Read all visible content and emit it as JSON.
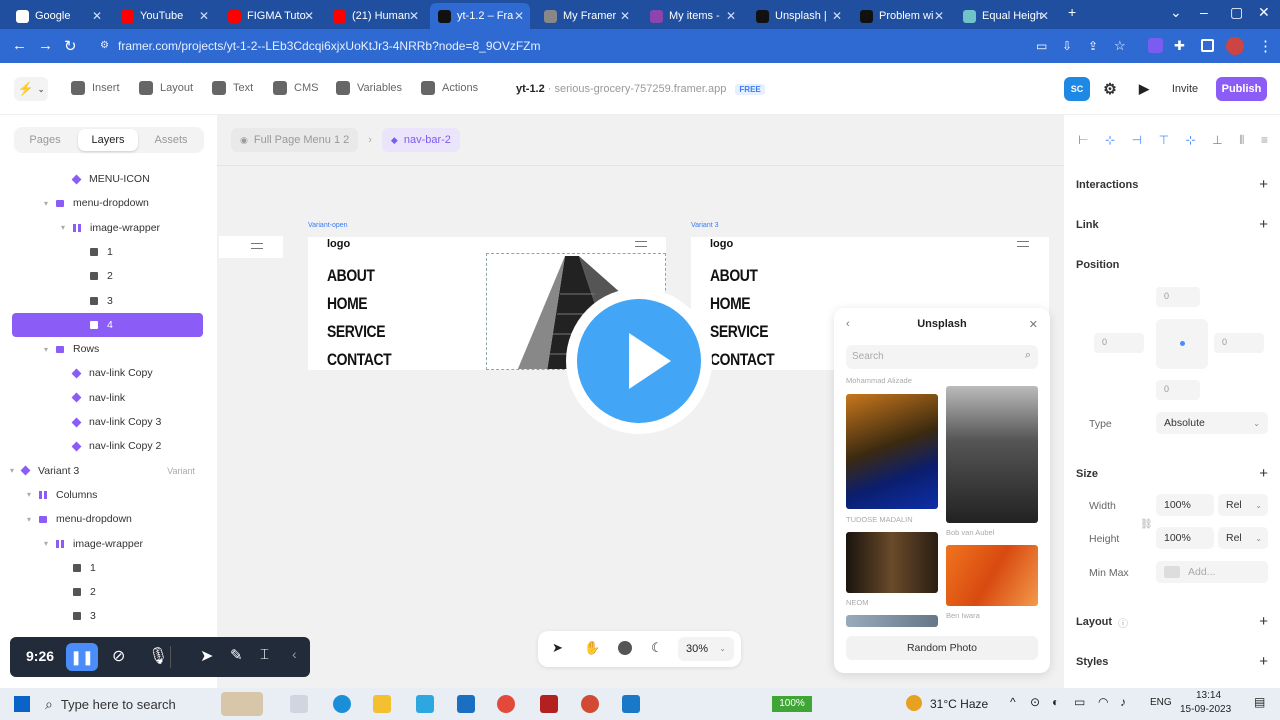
{
  "browser": {
    "tabs": [
      {
        "label": "Google",
        "color": "#ffffff"
      },
      {
        "label": "YouTube",
        "color": "#ff0000"
      },
      {
        "label": "FIGMA Tuto",
        "color": "#ff0000"
      },
      {
        "label": "(21) Human",
        "color": "#ff0000"
      },
      {
        "label": "yt-1.2 – Fra",
        "color": "#111111"
      },
      {
        "label": "My Framer",
        "color": "#888888"
      },
      {
        "label": "My items -",
        "color": "#8e44ad"
      },
      {
        "label": "Unsplash |",
        "color": "#111111"
      },
      {
        "label": "Problem wi",
        "color": "#111111"
      },
      {
        "label": "Equal Heigh",
        "color": "#6fc3c9"
      }
    ],
    "new_tab": "+",
    "url": "framer.com/projects/yt-1-2--LEb3Cdcqi6xjxUoKtJr3-4NRRb?node=8_9OVzFZm"
  },
  "toolbar": {
    "items": [
      "Insert",
      "Layout",
      "Text",
      "CMS",
      "Variables",
      "Actions"
    ],
    "project_name": "yt-1.2",
    "project_url": "serious-grocery-757259.framer.app",
    "plan_badge": "FREE",
    "avatar_initials": "SC",
    "invite_label": "Invite",
    "publish_label": "Publish",
    "accent": "#8b5cf6"
  },
  "left_panel": {
    "tabs": [
      "Pages",
      "Layers",
      "Assets"
    ],
    "active_tab": "Layers",
    "layers": [
      {
        "label": "MENU-ICON",
        "icon": "component-icon",
        "indent": 3
      },
      {
        "label": "menu-dropdown",
        "icon": "stack-icon",
        "indent": 2,
        "caret": true
      },
      {
        "label": "image-wrapper",
        "icon": "columns-icon",
        "indent": 3,
        "caret": true
      },
      {
        "label": "1",
        "icon": "frame-icon",
        "indent": 4
      },
      {
        "label": "2",
        "icon": "frame-icon",
        "indent": 4
      },
      {
        "label": "3",
        "icon": "frame-icon",
        "indent": 4
      },
      {
        "label": "4",
        "icon": "frame-icon",
        "indent": 4,
        "selected": true
      },
      {
        "label": "Rows",
        "icon": "stack-icon",
        "indent": 2,
        "caret": true
      },
      {
        "label": "nav-link Copy",
        "icon": "component-icon",
        "indent": 3
      },
      {
        "label": "nav-link",
        "icon": "component-icon",
        "indent": 3
      },
      {
        "label": "nav-link Copy 3",
        "icon": "component-icon",
        "indent": 3
      },
      {
        "label": "nav-link Copy 2",
        "icon": "component-icon",
        "indent": 3
      },
      {
        "label": "Variant 3",
        "icon": "component-icon",
        "indent": 0,
        "caret": true,
        "right": "Variant"
      },
      {
        "label": "Columns",
        "icon": "columns-icon",
        "indent": 1,
        "caret": true
      },
      {
        "label": "menu-dropdown",
        "icon": "stack-icon",
        "indent": 1,
        "caret": true
      },
      {
        "label": "image-wrapper",
        "icon": "columns-icon",
        "indent": 2,
        "caret": true
      },
      {
        "label": "1",
        "icon": "frame-icon",
        "indent": 3
      },
      {
        "label": "2",
        "icon": "frame-icon",
        "indent": 3
      },
      {
        "label": "3",
        "icon": "frame-icon",
        "indent": 3
      }
    ]
  },
  "canvas": {
    "breadcrumb": [
      "Full Page Menu 1 2",
      "nav-bar-2"
    ],
    "variant_open_label": "Variant-open",
    "variant3_label": "Variant 3",
    "logo": "logo",
    "nav_links": [
      "ABOUT",
      "HOME",
      "SERVICE",
      "CONTACT"
    ],
    "zoom": "30%"
  },
  "unsplash_panel": {
    "title": "Unsplash",
    "search_placeholder": "Search",
    "credits": [
      "Mohammad Alizade",
      "TUDOSE MADALIN",
      "Bob van Aubel",
      "NEOM",
      "Ben Iwara"
    ],
    "random_button": "Random Photo"
  },
  "recorder": {
    "time": "9:26"
  },
  "right_panel": {
    "sections": [
      "Interactions",
      "Link",
      "Position",
      "Size",
      "Layout",
      "Styles"
    ],
    "position": {
      "top": "0",
      "left": "0",
      "right": "0",
      "bottom": "0",
      "type_label": "Type",
      "type_value": "Absolute"
    },
    "size": {
      "width_label": "Width",
      "width_value": "100%",
      "width_unit": "Rel",
      "height_label": "Height",
      "height_value": "100%",
      "height_unit": "Rel",
      "minmax_label": "Min Max",
      "minmax_value": "Add..."
    }
  },
  "taskbar": {
    "search_placeholder": "Type here to search",
    "battery": "100%",
    "weather": "31°C Haze",
    "language": "ENG",
    "time": "13:14",
    "date": "15-09-2023"
  }
}
